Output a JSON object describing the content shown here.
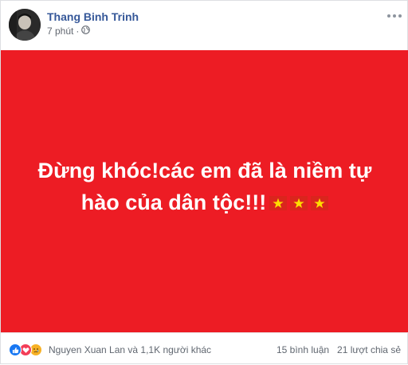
{
  "post": {
    "author": "Thang Binh Trinh",
    "time": "7 phút",
    "separator": "·",
    "privacy_icon": "globe-icon",
    "more_icon": "more-options-icon"
  },
  "banner": {
    "background": "#ed1c24",
    "text_line1": "Đừng khóc!các em đã là niềm tự",
    "text_line2": "hào của dân tộc!!!",
    "flag_icon": "vietnam-flag-icon",
    "flag_count": 3
  },
  "footer": {
    "reaction_icons": [
      "like-icon",
      "love-icon",
      "sad-icon"
    ],
    "reactions_text": "Nguyen Xuan Lan và 1,1K người khác",
    "comments": "15 bình luận",
    "shares": "21 lượt chia sẻ"
  }
}
